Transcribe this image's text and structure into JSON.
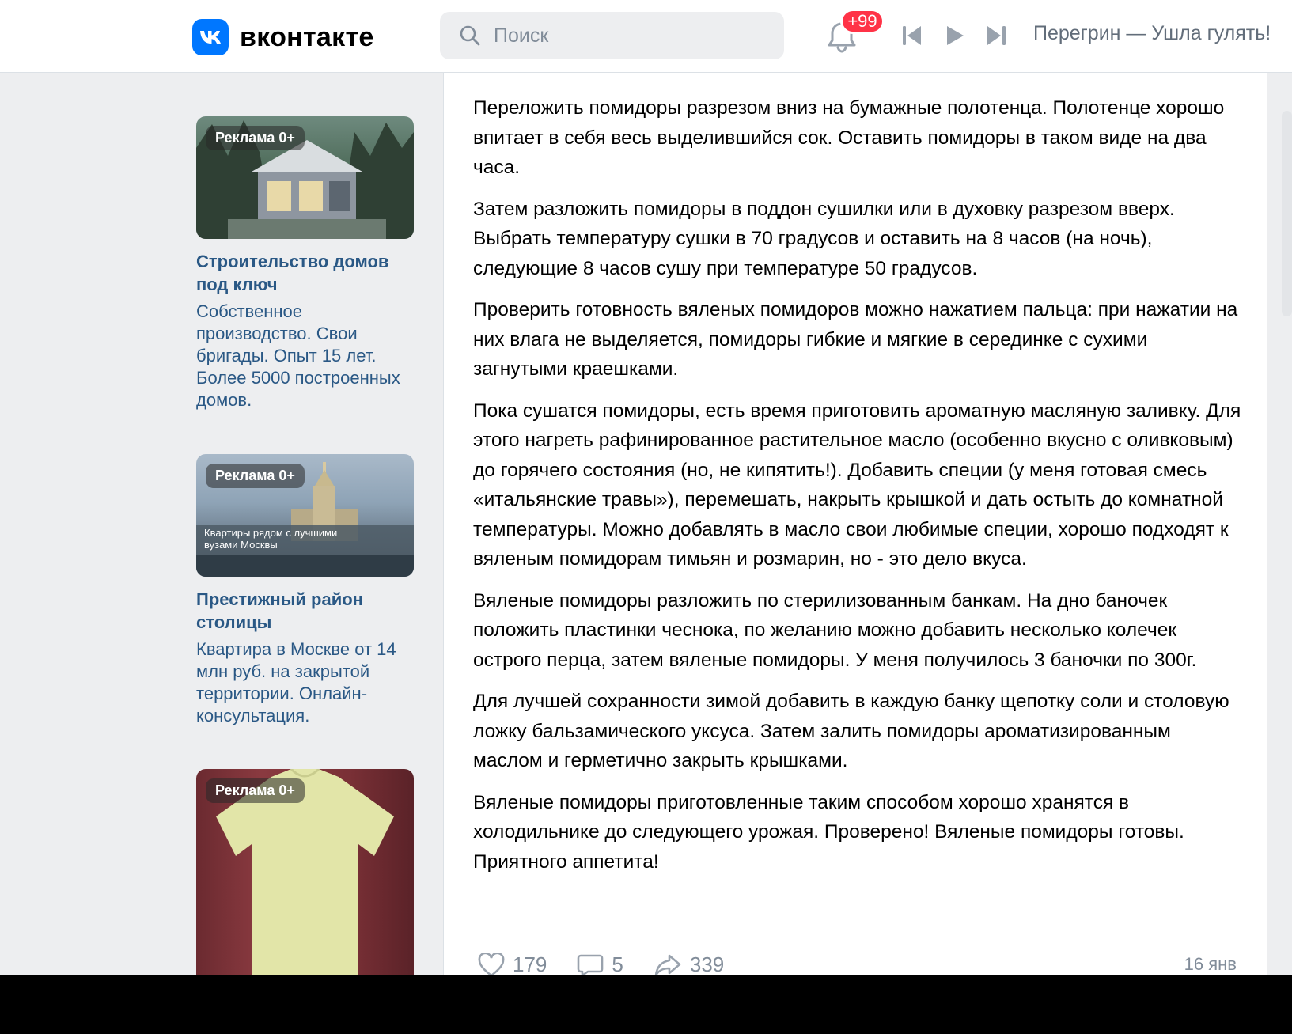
{
  "header": {
    "logo_text": "вконтакте",
    "search_placeholder": "Поиск",
    "notifications_badge": "+99",
    "now_playing": "Перегрин — Ушла гулять!"
  },
  "ads": [
    {
      "label": "Реклама 0+",
      "title": "Строительство домов под ключ",
      "description": "Собственное производство. Свои бригады. Опыт 15 лет. Более 5000 построенных домов."
    },
    {
      "label": "Реклама 0+",
      "title": "Престижный район столицы",
      "description": "Квартира в Москве от 14 млн руб. на закрытой территории. Онлайн-консультация.",
      "image_caption": "Квартиры рядом с лучшими вузами Москвы"
    },
    {
      "label": "Реклама 0+"
    }
  ],
  "post": {
    "paragraphs": [
      "Переложить помидоры разрезом вниз на бумажные полотенца. Полотенце хорошо впитает в себя весь выделившийся сок. Оставить помидоры в таком виде на два часа.",
      "Затем разложить помидоры в поддон сушилки или в духовку разрезом вверх. Выбрать температуру сушки в 70 градусов и оставить на 8 часов (на ночь), следующие 8 часов сушу при температуре 50 градусов.",
      "Проверить готовность вяленых помидоров можно нажатием пальца: при нажатии на них влага не выделяется, помидоры гибкие и мягкие в серединке с сухими загнутыми краешками.",
      "Пока сушатся помидоры, есть время приготовить ароматную масляную заливку. Для этого нагреть рафинированное растительное масло (особенно вкусно с оливковым) до горячего состояния (но, не кипятить!). Добавить специи (у меня готовая смесь «итальянские травы»), перемешать, накрыть крышкой и дать остыть до комнатной температуры. Можно добавлять в масло свои любимые специи, хорошо подходят к вяленым помидорам тимьян и розмарин, но - это дело вкуса.",
      "Вяленые помидоры разложить по стерилизованным банкам. На дно баночек положить пластинки чеснока, по желанию можно добавить несколько колечек острого перца, затем вяленые помидоры. У меня получилось 3 баночки по 300г.",
      "Для лучшей сохранности зимой добавить в каждую банку щепотку соли и столовую ложку бальзамического уксуса. Затем залить помидоры ароматизированным маслом и герметично закрыть крышками.",
      "Вяленые помидоры приготовленные таким способом хорошо хранятся в холодильнике до следующего урожая. Проверено! Вяленые помидоры готовы. Приятного аппетита!"
    ],
    "likes": "179",
    "comments": "5",
    "shares": "339",
    "date": "16 янв"
  },
  "colors": {
    "accent": "#0077ff",
    "link": "#2a5885",
    "badge": "#ff3347",
    "page_bg": "#edeef0"
  }
}
